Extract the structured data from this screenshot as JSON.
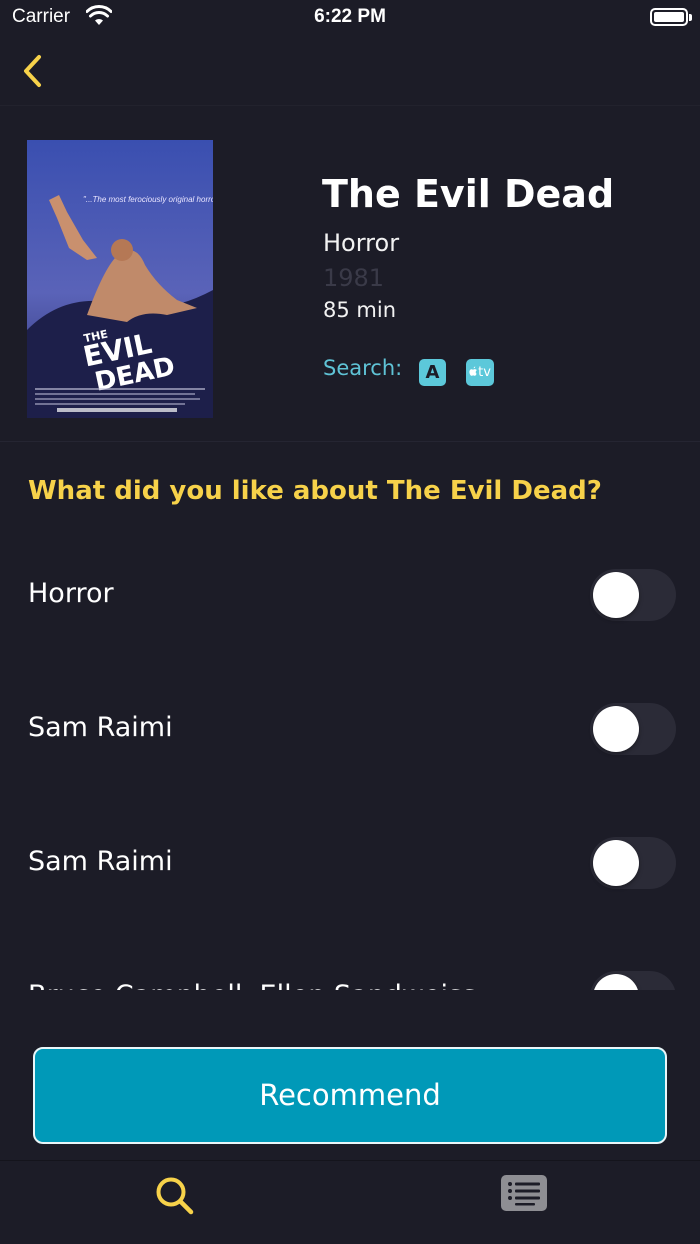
{
  "status_bar": {
    "carrier": "Carrier",
    "time": "6:22 PM"
  },
  "movie": {
    "title": "The Evil Dead",
    "genre": "Horror",
    "year": "1981",
    "runtime": "85 min",
    "poster": {
      "tagline": "\"...The most ferociously original horror film of the year...\"",
      "logo_line1": "THE",
      "logo_line2": "EVIL",
      "logo_line3": "DEAD"
    }
  },
  "search": {
    "label": "Search:",
    "amazon_label": "A",
    "appletv_label": "tv"
  },
  "question": "What did you like about The Evil Dead?",
  "toggles": [
    {
      "label": "Horror",
      "on": false
    },
    {
      "label": "Sam Raimi",
      "on": false
    },
    {
      "label": "Sam Raimi",
      "on": false
    },
    {
      "label": "Bruce Campbell, Ellen Sandweiss",
      "on": false
    }
  ],
  "recommend_label": "Recommend",
  "colors": {
    "background": "#1c1c27",
    "accent_yellow": "#f7d24a",
    "accent_teal": "#0099b8",
    "link_teal": "#5fc3d6"
  },
  "tab_bar": {
    "items": [
      {
        "icon": "search-icon",
        "selected": true
      },
      {
        "icon": "list-icon",
        "selected": false
      }
    ]
  }
}
